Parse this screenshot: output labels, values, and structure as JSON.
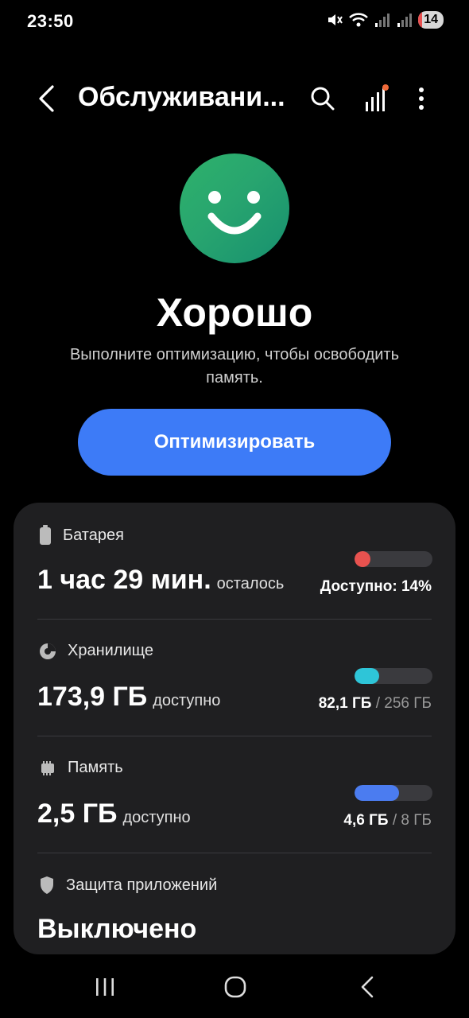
{
  "status_bar": {
    "time": "23:50",
    "battery": "14"
  },
  "header": {
    "title": "Обслуживани..."
  },
  "status": {
    "title": "Хорошо",
    "description": "Выполните оптимизацию, чтобы освободить память."
  },
  "optimize_button": "Оптимизировать",
  "battery": {
    "label": "Батарея",
    "value": "1 час 29 мин.",
    "suffix": "осталось",
    "available": "Доступно: 14%",
    "level": 0.14,
    "color": "#e8524f"
  },
  "storage": {
    "label": "Хранилище",
    "value": "173,9 ГБ",
    "suffix": "доступно",
    "used": "82,1 ГБ",
    "total": "/ 256 ГБ",
    "level": 0.32,
    "color": "#2ec5d8"
  },
  "memory": {
    "label": "Память",
    "value": "2,5 ГБ",
    "suffix": "доступно",
    "used": "4,6 ГБ",
    "total": "/ 8 ГБ",
    "level": 0.575,
    "color": "#4b7cf0"
  },
  "protection": {
    "label": "Защита приложений",
    "value": "Выключено"
  },
  "accent": "#3d7bf7"
}
